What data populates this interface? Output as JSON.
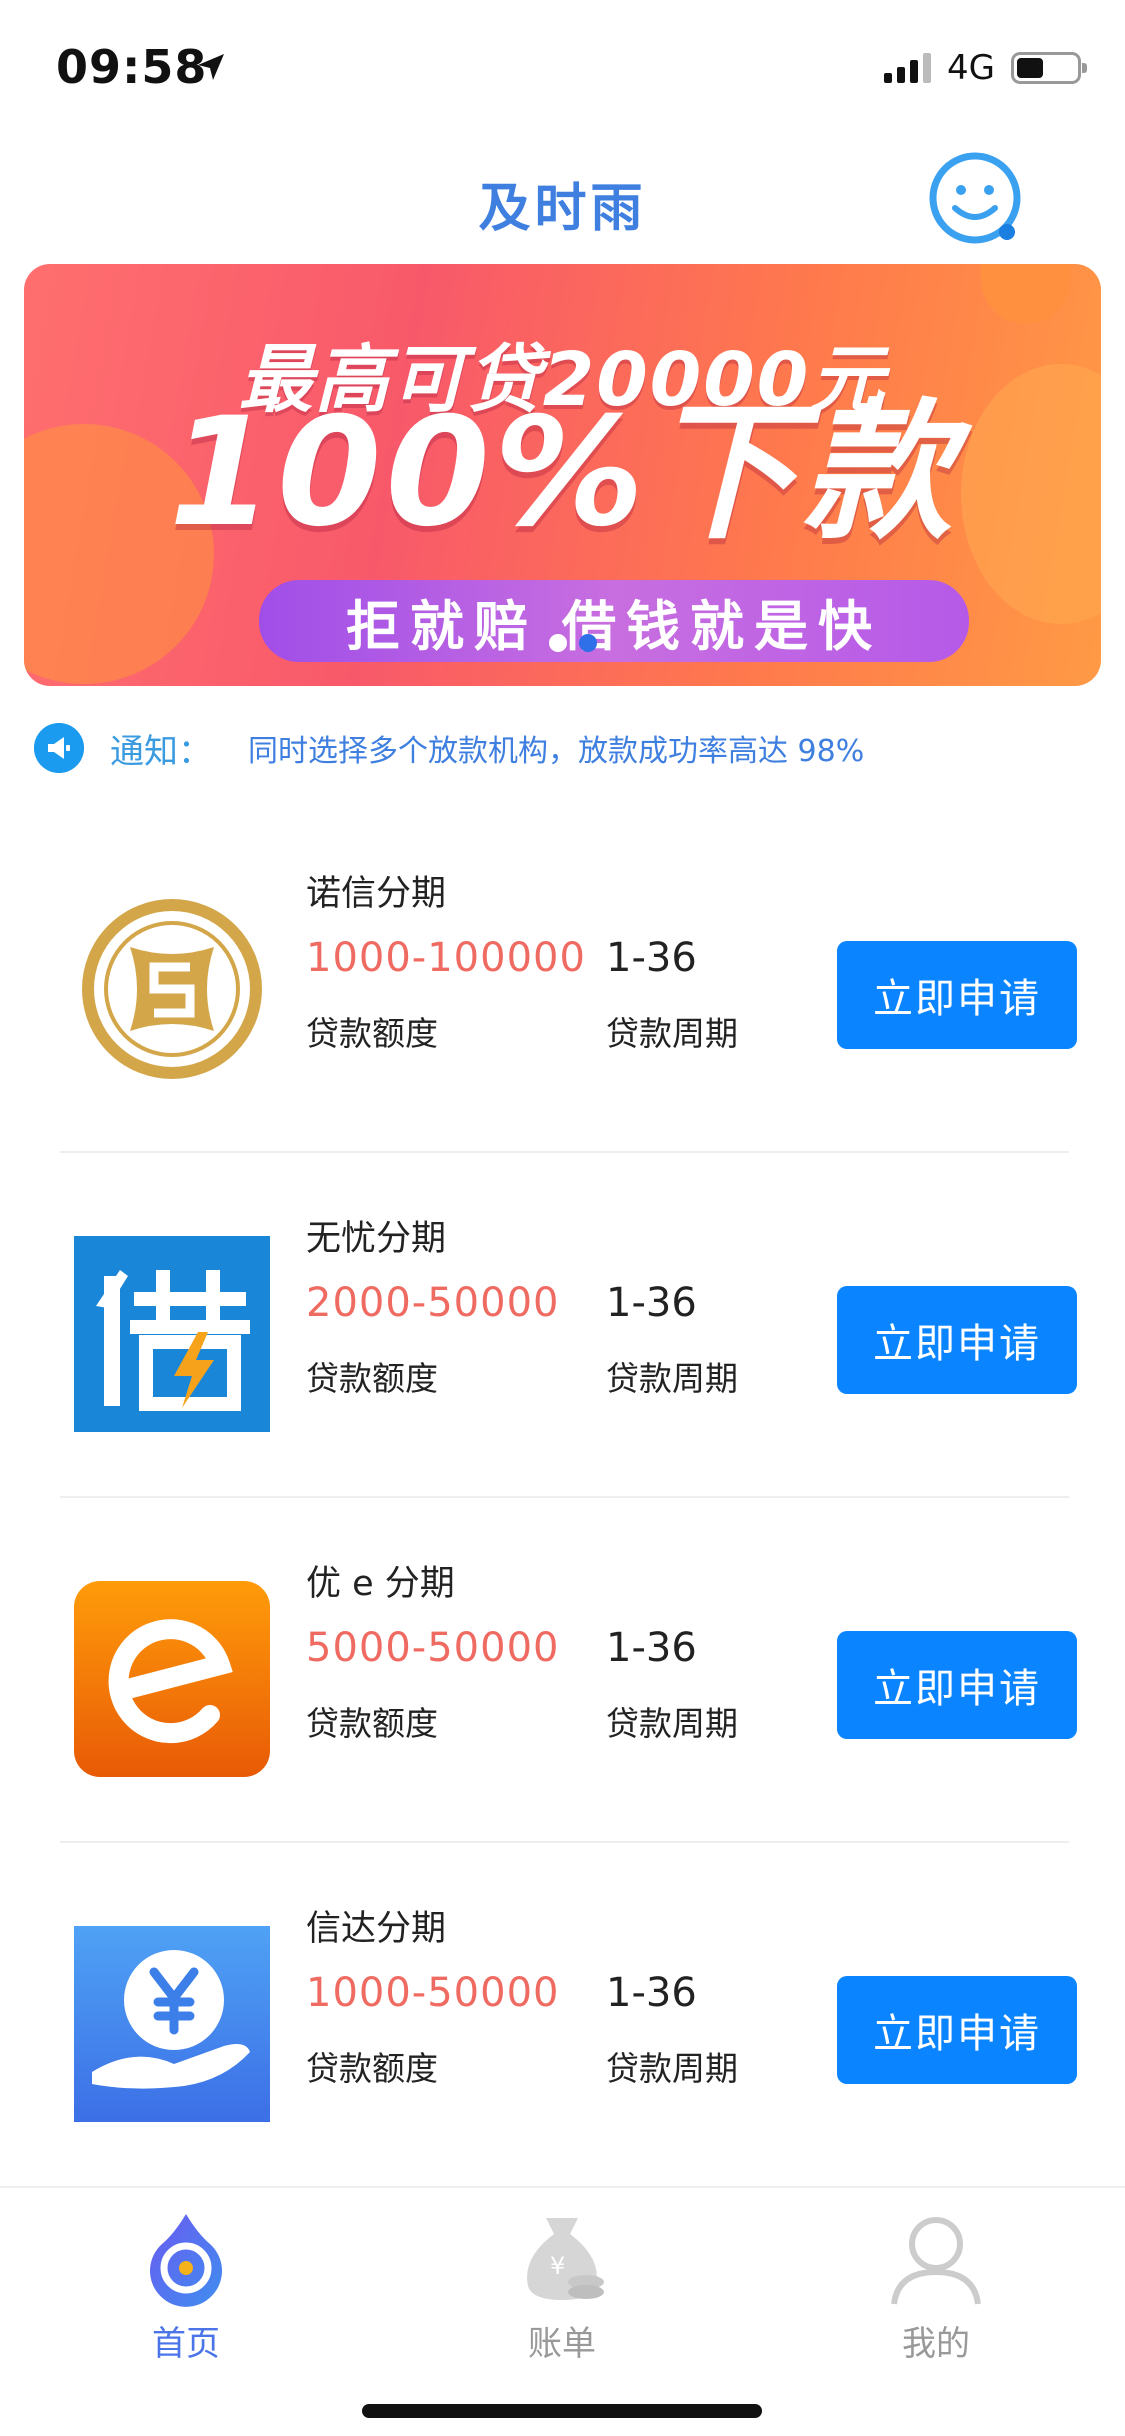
{
  "status_bar": {
    "time": "09:58",
    "network": "4G",
    "icons": [
      "location-arrow-icon",
      "signal-icon",
      "battery-icon"
    ]
  },
  "header": {
    "title": "及时雨",
    "service_icon": "smiley-service-icon"
  },
  "banner": {
    "line1": "最高可贷20000元",
    "line2": "100%下款",
    "pill_left": "拒就赔",
    "pill_right": "借钱就是快",
    "dot_count": 2,
    "active_dot": 1
  },
  "notice": {
    "icon": "megaphone-icon",
    "label": "通知：",
    "text": "同时选择多个放款机构，放款成功率高达 98%"
  },
  "loans": [
    {
      "name": "诺信分期",
      "amount": "1000-100000",
      "period": "1-36",
      "amount_label": "贷款额度",
      "period_label": "贷款周期",
      "button": "立即申请",
      "icon": "nuoxin-coin-logo-icon"
    },
    {
      "name": "无忧分期",
      "amount": "2000-50000",
      "period": "1-36",
      "amount_label": "贷款额度",
      "period_label": "贷款周期",
      "button": "立即申请",
      "icon": "jie-character-logo-icon"
    },
    {
      "name": "优 e 分期",
      "amount": "5000-50000",
      "period": "1-36",
      "amount_label": "贷款额度",
      "period_label": "贷款周期",
      "button": "立即申请",
      "icon": "e-letter-logo-icon"
    },
    {
      "name": "信达分期",
      "amount": "1000-50000",
      "period": "1-36",
      "amount_label": "贷款额度",
      "period_label": "贷款周期",
      "button": "立即申请",
      "icon": "yen-hand-logo-icon"
    }
  ],
  "tabbar": {
    "active": "home",
    "tabs": [
      {
        "label": "首页",
        "icon": "home-drop-icon"
      },
      {
        "label": "账单",
        "icon": "money-bag-icon"
      },
      {
        "label": "我的",
        "icon": "user-icon"
      }
    ]
  },
  "colors": {
    "accent": "#0a84ff",
    "title": "#3f7fe0",
    "amount": "#ef6b62",
    "tab_active": "#4a74e8"
  }
}
